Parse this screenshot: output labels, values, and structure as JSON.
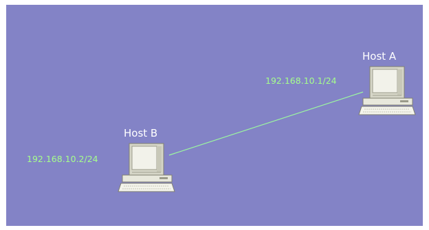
{
  "diagram": {
    "background_color": "#8383c6",
    "link_color": "#9cf7a0",
    "ip_label_color": "#a6ff8c",
    "host_label_color": "#ffffff",
    "hosts": [
      {
        "label": "Host A",
        "ip": "192.168.10.1/24",
        "icon": "desktop-computer-icon"
      },
      {
        "label": "Host B",
        "ip": "192.168.10.2/24",
        "icon": "desktop-computer-icon"
      }
    ],
    "links": [
      {
        "from": "Host B",
        "to": "Host A"
      }
    ]
  }
}
